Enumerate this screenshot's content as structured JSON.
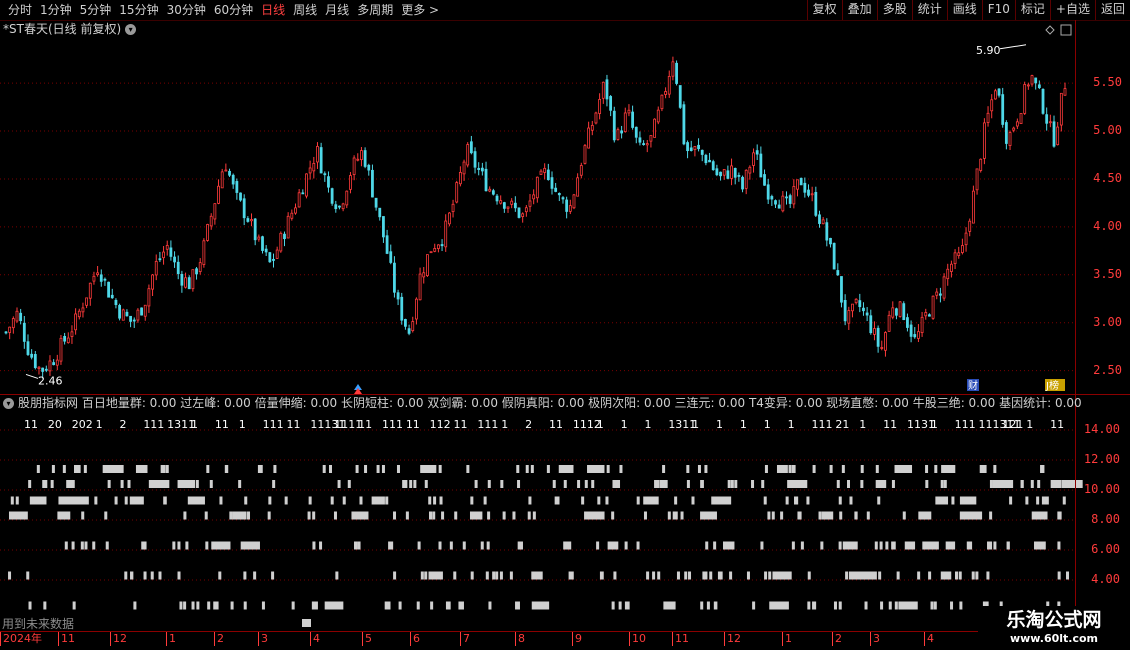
{
  "toolbar": {
    "periods": [
      "分时",
      "1分钟",
      "5分钟",
      "15分钟",
      "30分钟",
      "60分钟",
      "日线",
      "周线",
      "月线",
      "多周期",
      "更多 >"
    ],
    "active_period": "日线",
    "right_buttons": [
      "复权",
      "叠加",
      "多股",
      "统计",
      "画线",
      "F10",
      "标记",
      "+自选",
      "返回"
    ]
  },
  "main_chart": {
    "title": "*ST春天(日线 前复权)",
    "price_axis": [
      "5.50",
      "5.00",
      "4.50",
      "4.00",
      "3.50",
      "3.00",
      "2.50"
    ],
    "high_label": "5.90",
    "low_label": "2.46",
    "markers": [
      "财",
      "J榜"
    ]
  },
  "indicator": {
    "title": "股朋指标网 百日地量群: 0.00 过左峰: 0.00 倍量伸缩: 0.00 长阴短柱: 0.00 双剑霸: 0.00 假阴真阳: 0.00 极阴次阳: 0.00 三连元: 0.00 T4变异: 0.00 现场直憋: 0.00 牛股三绝: 0.00 基因统计: 0.00",
    "axis": [
      "14.00",
      "12.00",
      "10.00",
      "8.00",
      "6.00",
      "4.00"
    ],
    "count_labels": [
      "11",
      "20",
      "202",
      "1",
      "2",
      "111",
      "1311",
      "1",
      "11",
      "1",
      "111",
      "11",
      "11131",
      "1111",
      "11",
      "111",
      "11",
      "112",
      "11",
      "111",
      "1",
      "2",
      "11",
      "1112",
      "1",
      "1",
      "1",
      "1311",
      "1",
      "1",
      "1",
      "1",
      "1",
      "111",
      "21",
      "1",
      "11",
      "1131",
      "1",
      "111",
      "111311",
      "121",
      "1",
      "11"
    ],
    "footnote": "用到未来数据"
  },
  "date_axis": [
    "2024年",
    "11",
    "12",
    "1",
    "2",
    "3",
    "4",
    "5",
    "6",
    "7",
    "8",
    "9",
    "10",
    "11",
    "12",
    "1",
    "2",
    "3",
    "4"
  ],
  "watermark": {
    "name": "乐淘公式网",
    "url": "www.60lt.com"
  },
  "chart_data": {
    "type": "candlestick",
    "y_axis_ticks": [
      5.5,
      5.0,
      4.5,
      4.0,
      3.5,
      3.0,
      2.5
    ],
    "ylim": [
      2.35,
      5.95
    ],
    "annotated_high": 5.9,
    "annotated_low": 2.46,
    "close_trend": [
      2.9,
      3.1,
      2.7,
      2.5,
      2.6,
      2.8,
      3.0,
      3.3,
      3.6,
      3.3,
      3.1,
      3.0,
      3.2,
      3.6,
      3.8,
      3.5,
      3.4,
      3.7,
      4.2,
      4.7,
      4.3,
      4.1,
      3.8,
      3.6,
      3.9,
      4.2,
      4.5,
      4.8,
      4.4,
      4.2,
      4.6,
      4.8,
      4.3,
      3.8,
      3.2,
      2.9,
      3.5,
      3.8,
      3.9,
      4.3,
      4.8,
      4.6,
      4.4,
      4.3,
      4.2,
      4.1,
      4.4,
      4.6,
      4.3,
      4.2,
      4.7,
      5.1,
      5.5,
      4.9,
      5.2,
      4.8,
      4.9,
      5.3,
      5.8,
      4.8,
      4.8,
      4.7,
      4.5,
      4.6,
      4.4,
      4.8,
      4.4,
      4.3,
      4.2,
      4.5,
      4.3,
      4.0,
      3.6,
      3.0,
      3.2,
      3.0,
      2.7,
      3.2,
      3.1,
      2.8,
      3.1,
      3.3,
      3.6,
      3.7,
      4.3,
      5.0,
      5.5,
      4.9,
      5.2,
      5.6,
      5.3,
      4.9,
      5.5
    ],
    "indicator_levels": [
      14,
      12,
      10,
      8,
      6,
      4
    ]
  }
}
